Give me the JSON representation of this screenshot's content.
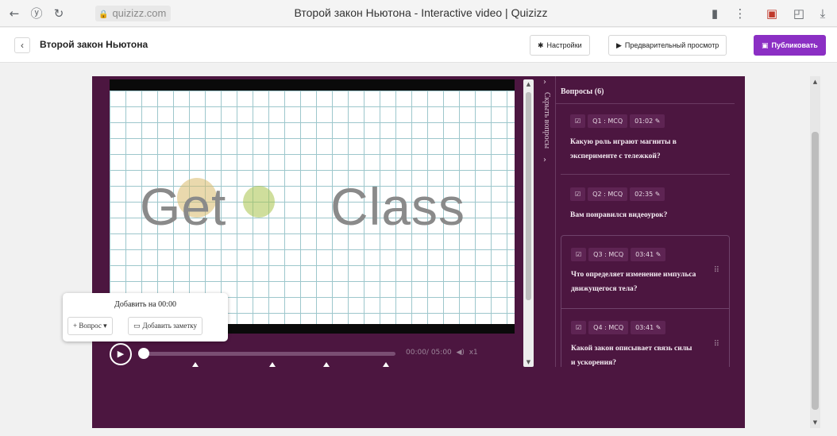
{
  "browser": {
    "url": "quizizz.com",
    "tab_title": "Второй закон Ньютона - Interactive video | Quizizz",
    "icons": [
      "back-arrow-icon",
      "yandex-icon",
      "reload-icon",
      "lock-icon",
      "bookmark-icon",
      "menu-dots-icon",
      "extension-icon",
      "collections-icon",
      "download-icon"
    ]
  },
  "header": {
    "title": "Второй закон Ньютона",
    "settings_label": "Настройки",
    "preview_label": "Предварительный просмотр",
    "publish_label": "Публиковать",
    "publish_color": "#8b2fc4"
  },
  "video": {
    "text_left": "Get",
    "text_right": "Class",
    "time": "00:00/ 05:00",
    "speed": "x1",
    "progress": 0
  },
  "collapse_label": "Скрыть вопросы",
  "questions": {
    "heading": "Вопросы (6)",
    "items": [
      {
        "tag": "Q1 : MCQ",
        "time": "01:02",
        "text": "Какую роль играют магниты в эксперименте с тележкой?"
      },
      {
        "tag": "Q2 : MCQ",
        "time": "02:35",
        "text": "Вам понравился видеоурок?"
      },
      {
        "tag": "Q3 : MCQ",
        "time": "03:41",
        "text": "Что определяет изменение импульса движущегося тела?"
      },
      {
        "tag": "Q4 : MCQ",
        "time": "03:41",
        "text": "Какой закон описывает связь силы и ускорения?"
      }
    ]
  },
  "popover": {
    "title": "Добавить на 00:00",
    "question_label": "+ Вопрос ▾",
    "note_label": "Добавить заметку"
  },
  "theme": {
    "player_bg": "#4c1640",
    "accent": "#8b2fc4"
  }
}
